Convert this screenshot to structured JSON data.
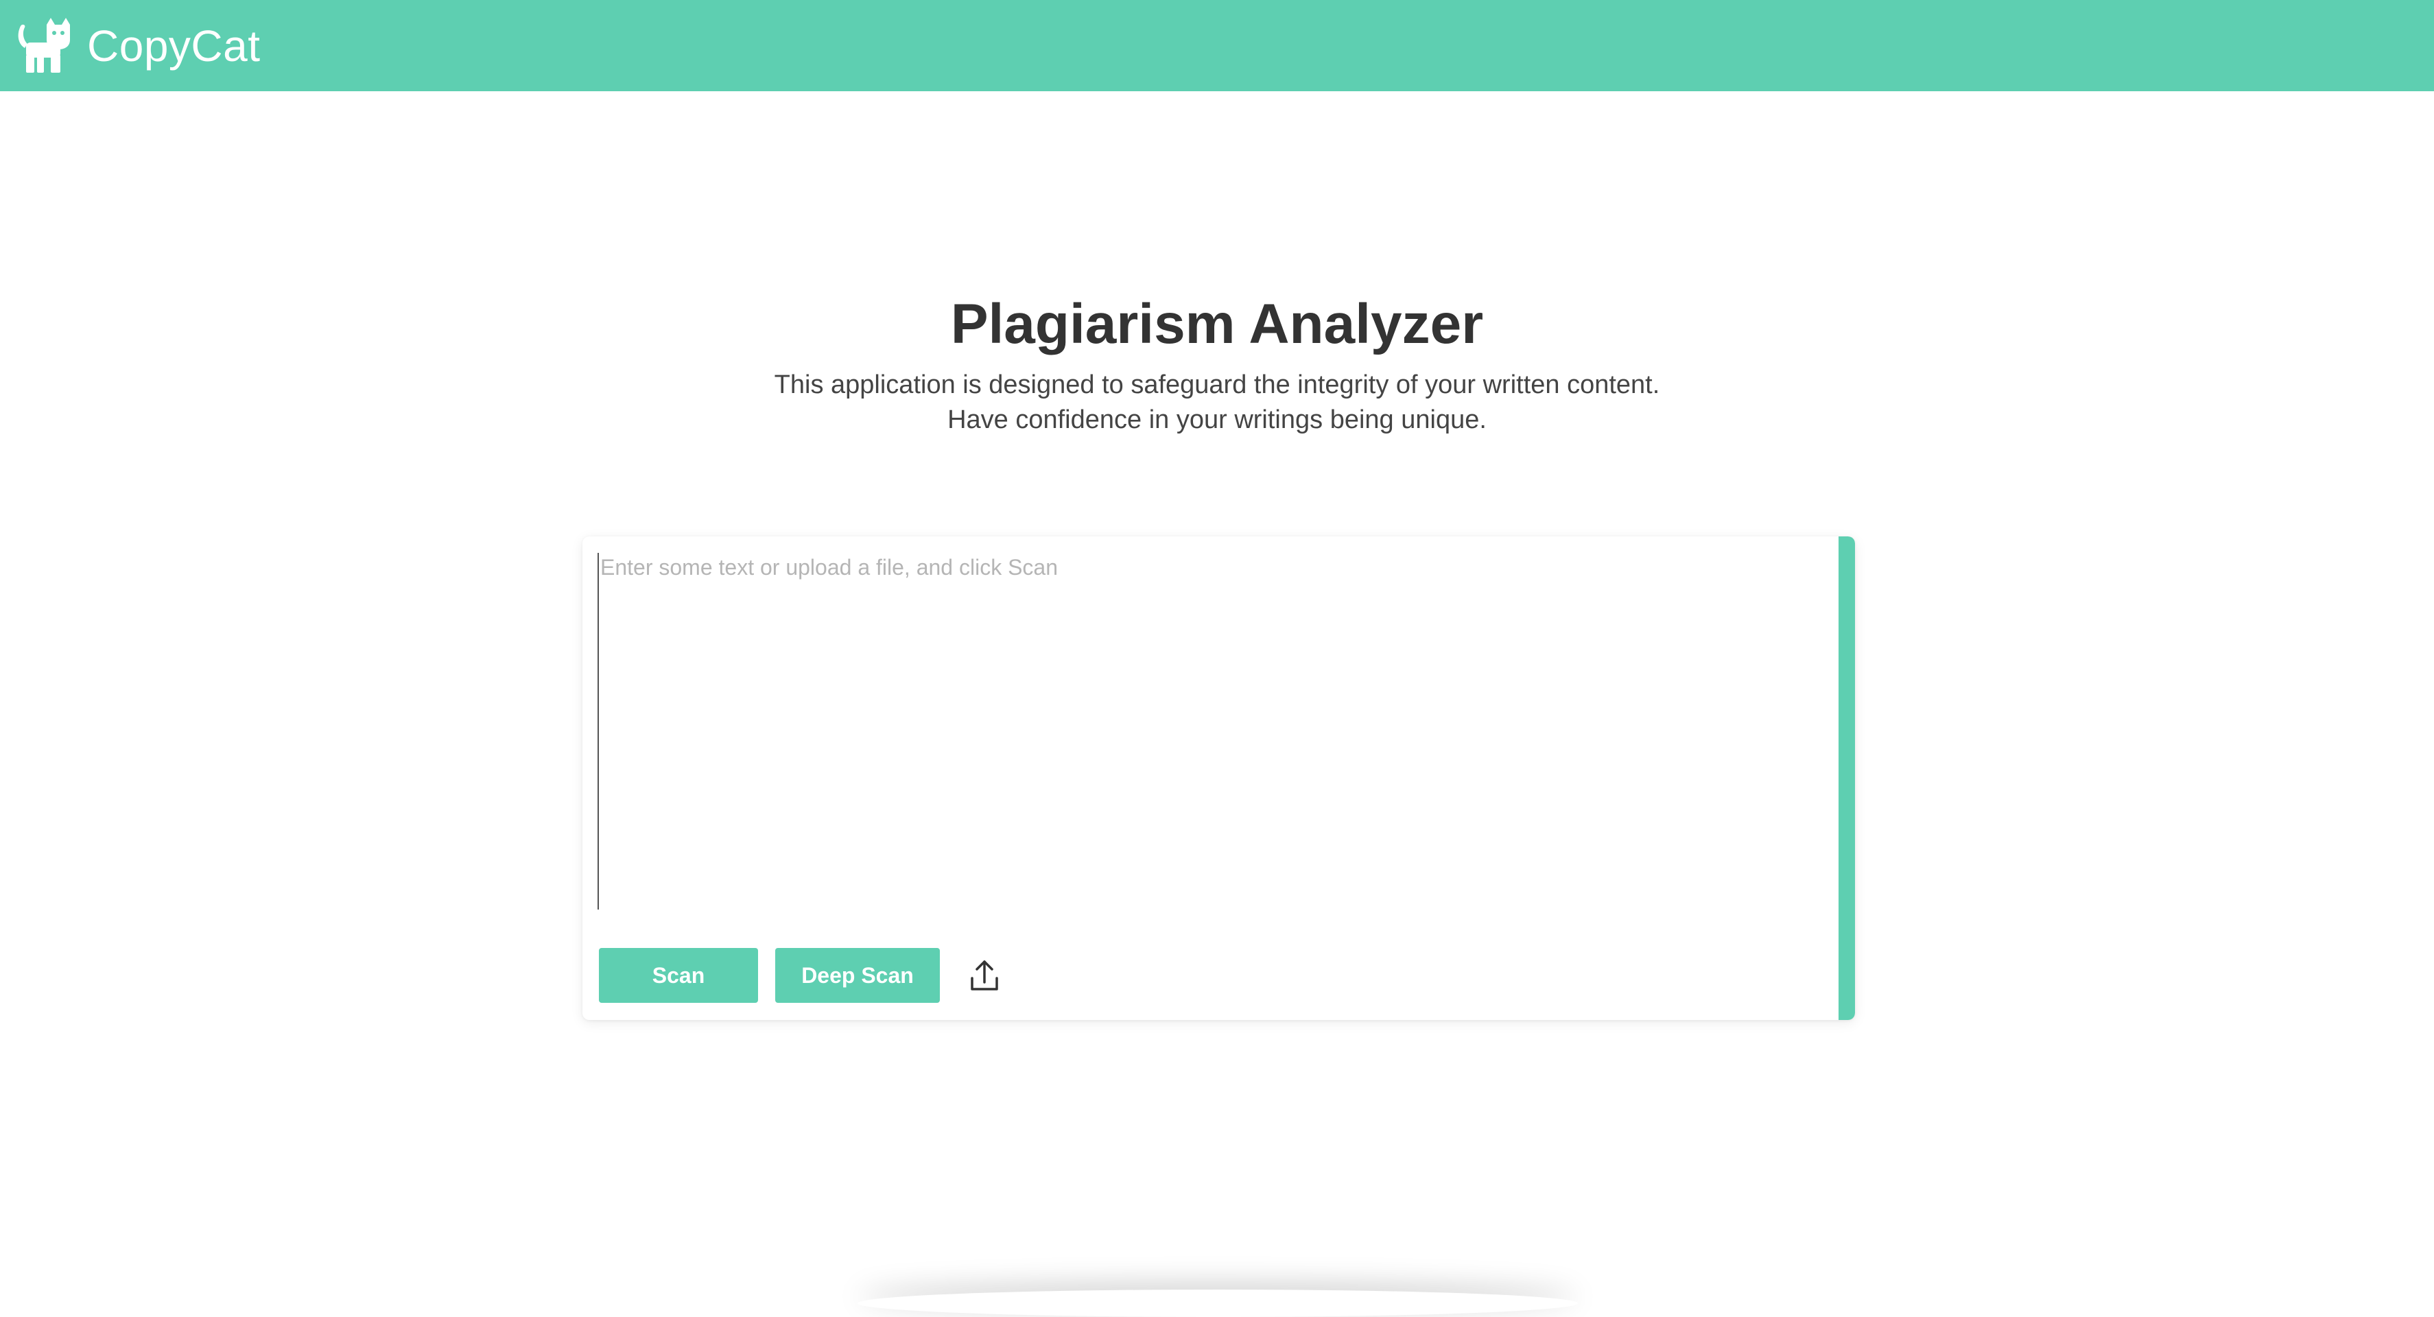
{
  "header": {
    "brand": "CopyCat",
    "logo_icon": "cat-icon",
    "background_color": "#5ecfb1"
  },
  "main": {
    "title": "Plagiarism Analyzer",
    "subtitle_line1": "This application is designed to safeguard the integrity of your written content.",
    "subtitle_line2": "Have confidence in your writings being unique."
  },
  "editor": {
    "placeholder": "Enter some text or upload a file, and click Scan",
    "value": "",
    "scan_label": "Scan",
    "deep_scan_label": "Deep Scan",
    "upload_icon": "upload-icon",
    "accent_color": "#5ecfb1"
  }
}
